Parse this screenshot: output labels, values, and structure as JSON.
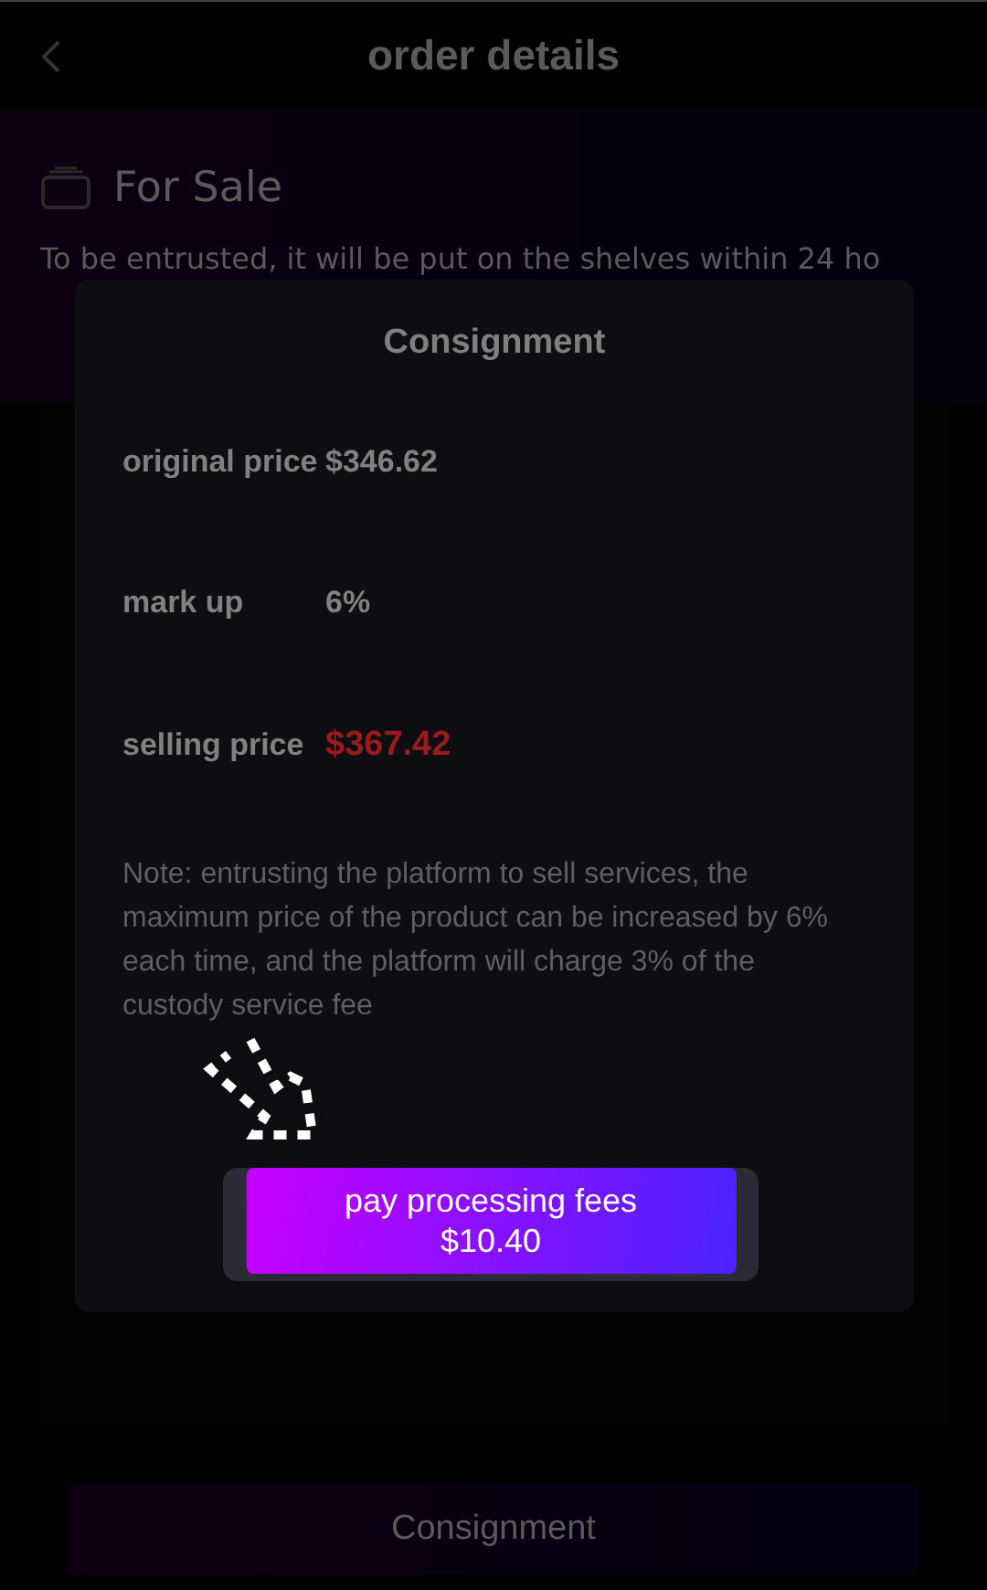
{
  "header": {
    "title": "order details"
  },
  "status": {
    "title": "For Sale",
    "description": "To be entrusted, it will be put on the shelves within 24 ho"
  },
  "modal": {
    "title": "Consignment",
    "rows": [
      {
        "kind": "plain",
        "label": "original price",
        "value": "$346.62"
      },
      {
        "kind": "plain",
        "label": "mark up",
        "value": "6%"
      },
      {
        "kind": "highlight",
        "label": "selling price",
        "value": "$367.42"
      }
    ],
    "note": "Note: entrusting the platform to sell services, the maximum price of the product can be increased by 6% each time, and the platform will charge 3% of the custody service fee",
    "button": {
      "label": "pay processing fees",
      "amount": "$10.40"
    }
  },
  "footer_button": "Consignment"
}
